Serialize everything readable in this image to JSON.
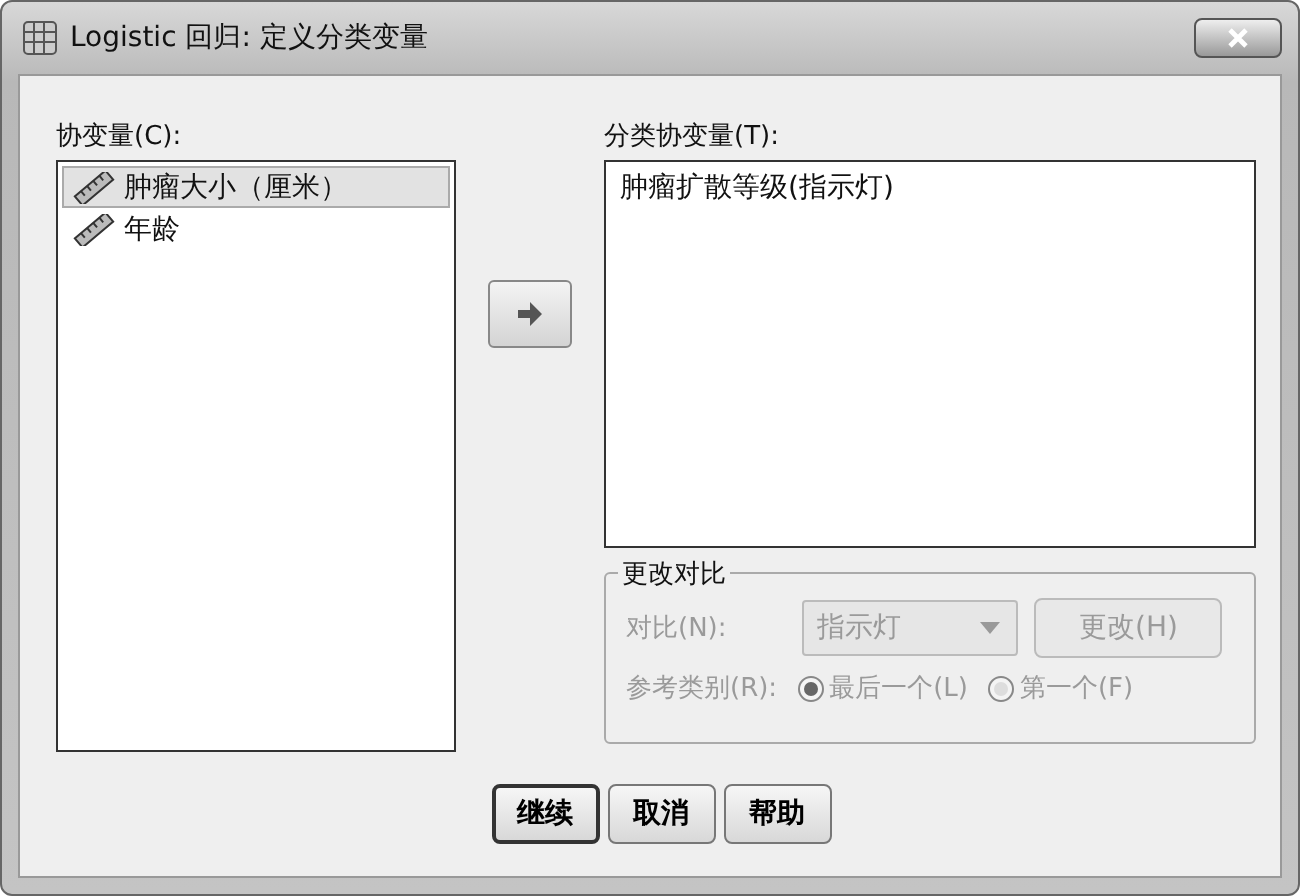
{
  "window": {
    "title": "Logistic 回归: 定义分类变量"
  },
  "covariates": {
    "label": "协变量(C):",
    "items": [
      {
        "label": "肿瘤大小（厘米）",
        "selected": true
      },
      {
        "label": "年龄",
        "selected": false
      }
    ]
  },
  "categorical": {
    "label": "分类协变量(T):",
    "items": [
      {
        "label": "肿瘤扩散等级(指示灯)",
        "selected": false
      }
    ]
  },
  "change_contrast": {
    "title": "更改对比",
    "disabled": true,
    "contrast_label": "对比(N):",
    "contrast_value": "指示灯",
    "change_button": "更改(H)",
    "reference_label": "参考类别(R):",
    "options": [
      {
        "label": "最后一个(L)",
        "selected": true
      },
      {
        "label": "第一个(F)",
        "selected": false
      }
    ]
  },
  "buttons": [
    {
      "label": "继续",
      "default": true
    },
    {
      "label": "取消",
      "default": false
    },
    {
      "label": "帮助",
      "default": false
    }
  ]
}
